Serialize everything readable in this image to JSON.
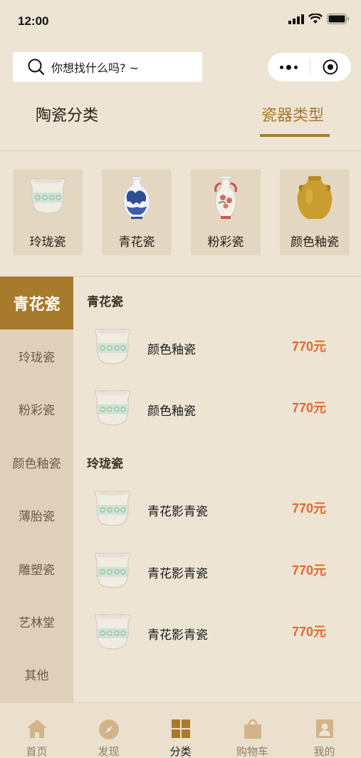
{
  "status": {
    "time": "12:00"
  },
  "search": {
    "placeholder": "你想找什么吗? ~"
  },
  "tabs": [
    {
      "label": "陶瓷分类",
      "active": false
    },
    {
      "label": "瓷器类型",
      "active": true
    }
  ],
  "categories": [
    {
      "label": "玲珑瓷",
      "icon": "linglong-pot-icon"
    },
    {
      "label": "青花瓷",
      "icon": "blue-white-vase-icon"
    },
    {
      "label": "粉彩瓷",
      "icon": "famille-rose-vase-icon"
    },
    {
      "label": "颜色釉瓷",
      "icon": "glaze-jar-icon"
    }
  ],
  "sidebar": {
    "items": [
      {
        "label": "青花瓷",
        "active": true
      },
      {
        "label": "玲珑瓷"
      },
      {
        "label": "粉彩瓷"
      },
      {
        "label": "颜色釉瓷"
      },
      {
        "label": "薄胎瓷"
      },
      {
        "label": "雕塑瓷"
      },
      {
        "label": "艺林堂"
      },
      {
        "label": "其他"
      }
    ]
  },
  "groups": [
    {
      "title": "青花瓷",
      "products": [
        {
          "name": "颜色釉瓷",
          "price": "770元"
        },
        {
          "name": "颜色釉瓷",
          "price": "770元"
        }
      ]
    },
    {
      "title": "玲珑瓷",
      "products": [
        {
          "name": "青花影青瓷",
          "price": "770元"
        },
        {
          "name": "青花影青瓷",
          "price": "770元"
        },
        {
          "name": "青花影青瓷",
          "price": "770元"
        }
      ]
    }
  ],
  "tabbar": [
    {
      "label": "首页",
      "icon": "home-icon"
    },
    {
      "label": "发现",
      "icon": "compass-icon"
    },
    {
      "label": "分类",
      "icon": "grid-icon",
      "active": true
    },
    {
      "label": "购物车",
      "icon": "shopping-bag-icon"
    },
    {
      "label": "我的",
      "icon": "profile-icon"
    }
  ],
  "colors": {
    "accent": "#a77a2c",
    "price": "#e46a2a",
    "background": "#ede4d4",
    "sidebar": "#dfd1b9"
  }
}
